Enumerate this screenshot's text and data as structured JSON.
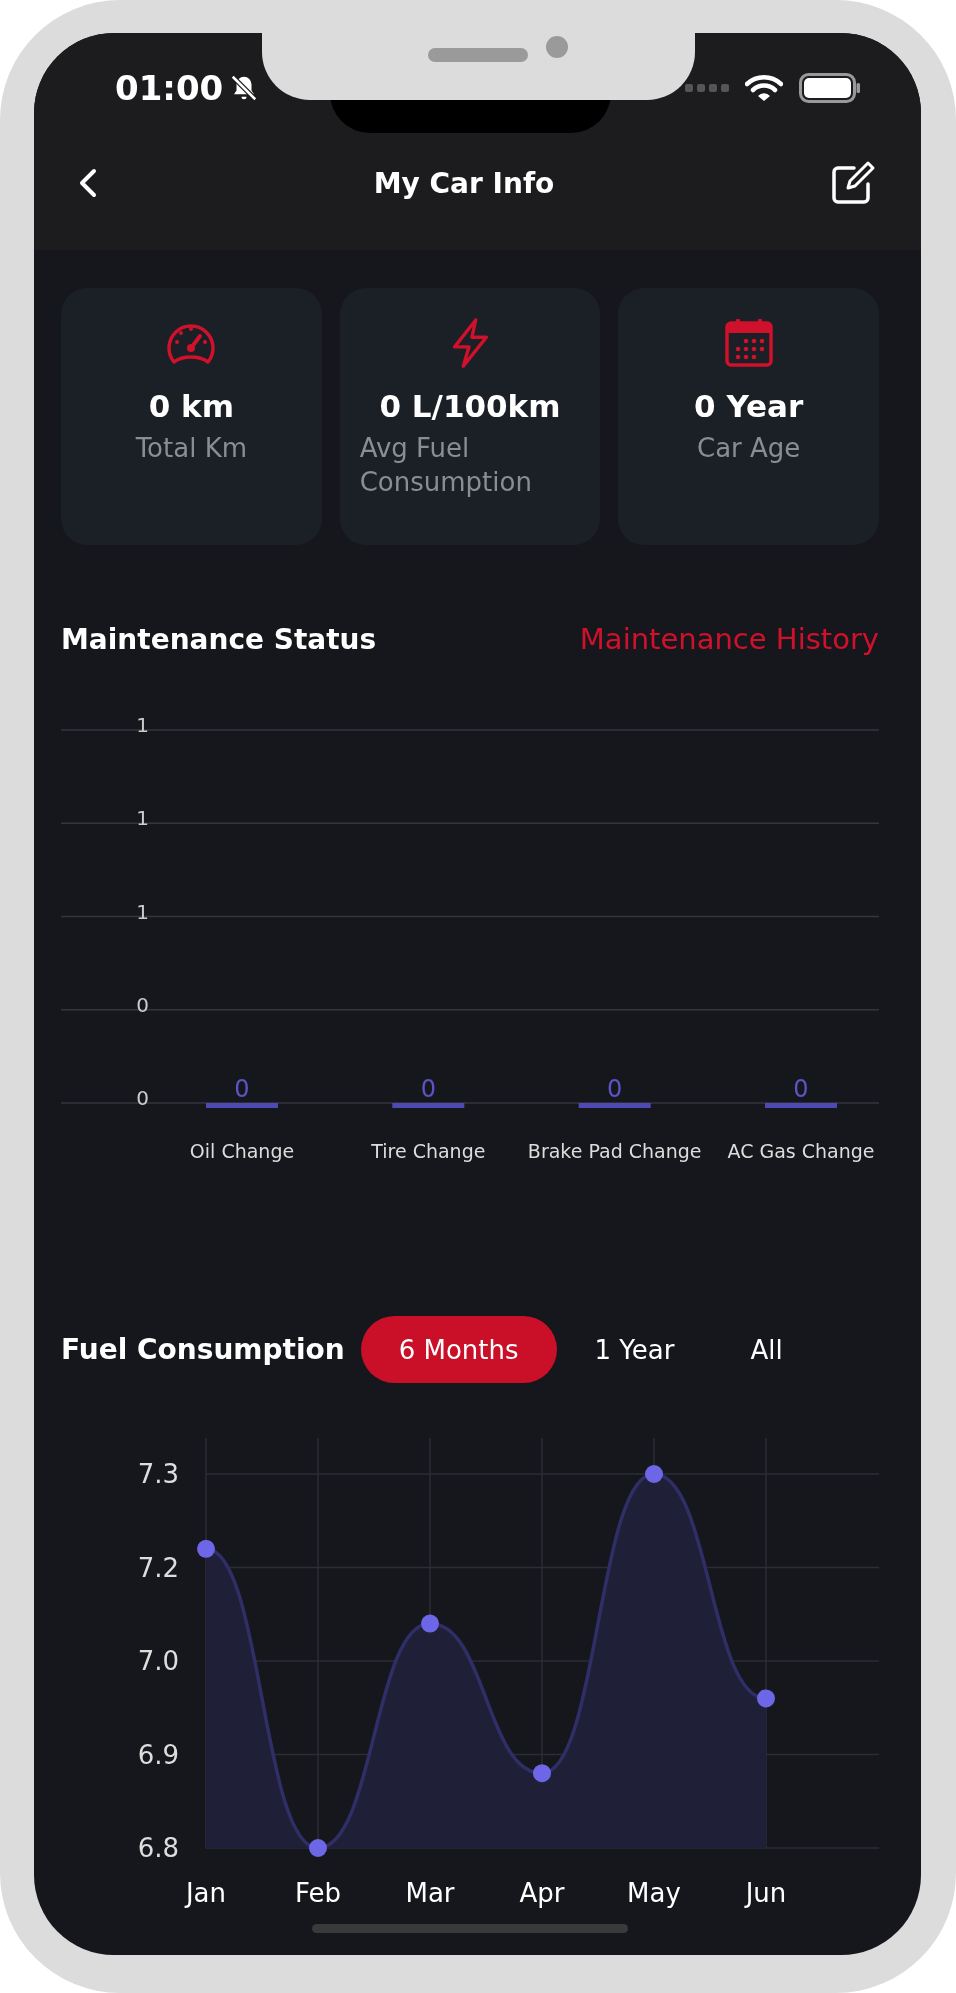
{
  "status_bar": {
    "time": "01:00"
  },
  "header": {
    "title": "My Car Info"
  },
  "stats": [
    {
      "kind": "speedometer",
      "value": "0 km",
      "label": "Total Km"
    },
    {
      "kind": "bolt",
      "value": "0 L/100km",
      "label": "Avg Fuel Consumption"
    },
    {
      "kind": "calendar",
      "value": "0 Year",
      "label": "Car Age"
    }
  ],
  "maintenance": {
    "title": "Maintenance Status",
    "link": "Maintenance History",
    "chart_data": {
      "type": "bar",
      "categories": [
        "Oil Change",
        "Tire Change",
        "Brake Pad Change",
        "AC Gas Change"
      ],
      "values": [
        0,
        0,
        0,
        0
      ],
      "ylim": [
        0,
        1
      ],
      "grid": true,
      "yticks": [
        {
          "value": 0,
          "label": "0"
        },
        {
          "value": 0.25,
          "label": "0"
        },
        {
          "value": 0.5,
          "label": "1"
        },
        {
          "value": 0.75,
          "label": "1"
        },
        {
          "value": 1,
          "label": "1"
        }
      ],
      "data_labels": true
    }
  },
  "fuel": {
    "title": "Fuel Consumption",
    "periods": [
      {
        "label": "6 Months",
        "selected": true
      },
      {
        "label": "1 Year",
        "selected": false
      },
      {
        "label": "All",
        "selected": false
      }
    ],
    "chart_data": {
      "type": "area",
      "x": [
        "Jan",
        "Feb",
        "Mar",
        "Apr",
        "May",
        "Jun"
      ],
      "values": [
        7.2,
        6.8,
        7.1,
        6.9,
        7.3,
        7.0
      ],
      "ylim": [
        6.8,
        7.3
      ],
      "grid": true,
      "yticks": [
        {
          "value": 6.8,
          "label": "6.8"
        },
        {
          "value": 6.925,
          "label": "6.9"
        },
        {
          "value": 7.05,
          "label": "7.0"
        },
        {
          "value": 7.175,
          "label": "7.2"
        },
        {
          "value": 7.3,
          "label": "7.3"
        }
      ]
    }
  }
}
